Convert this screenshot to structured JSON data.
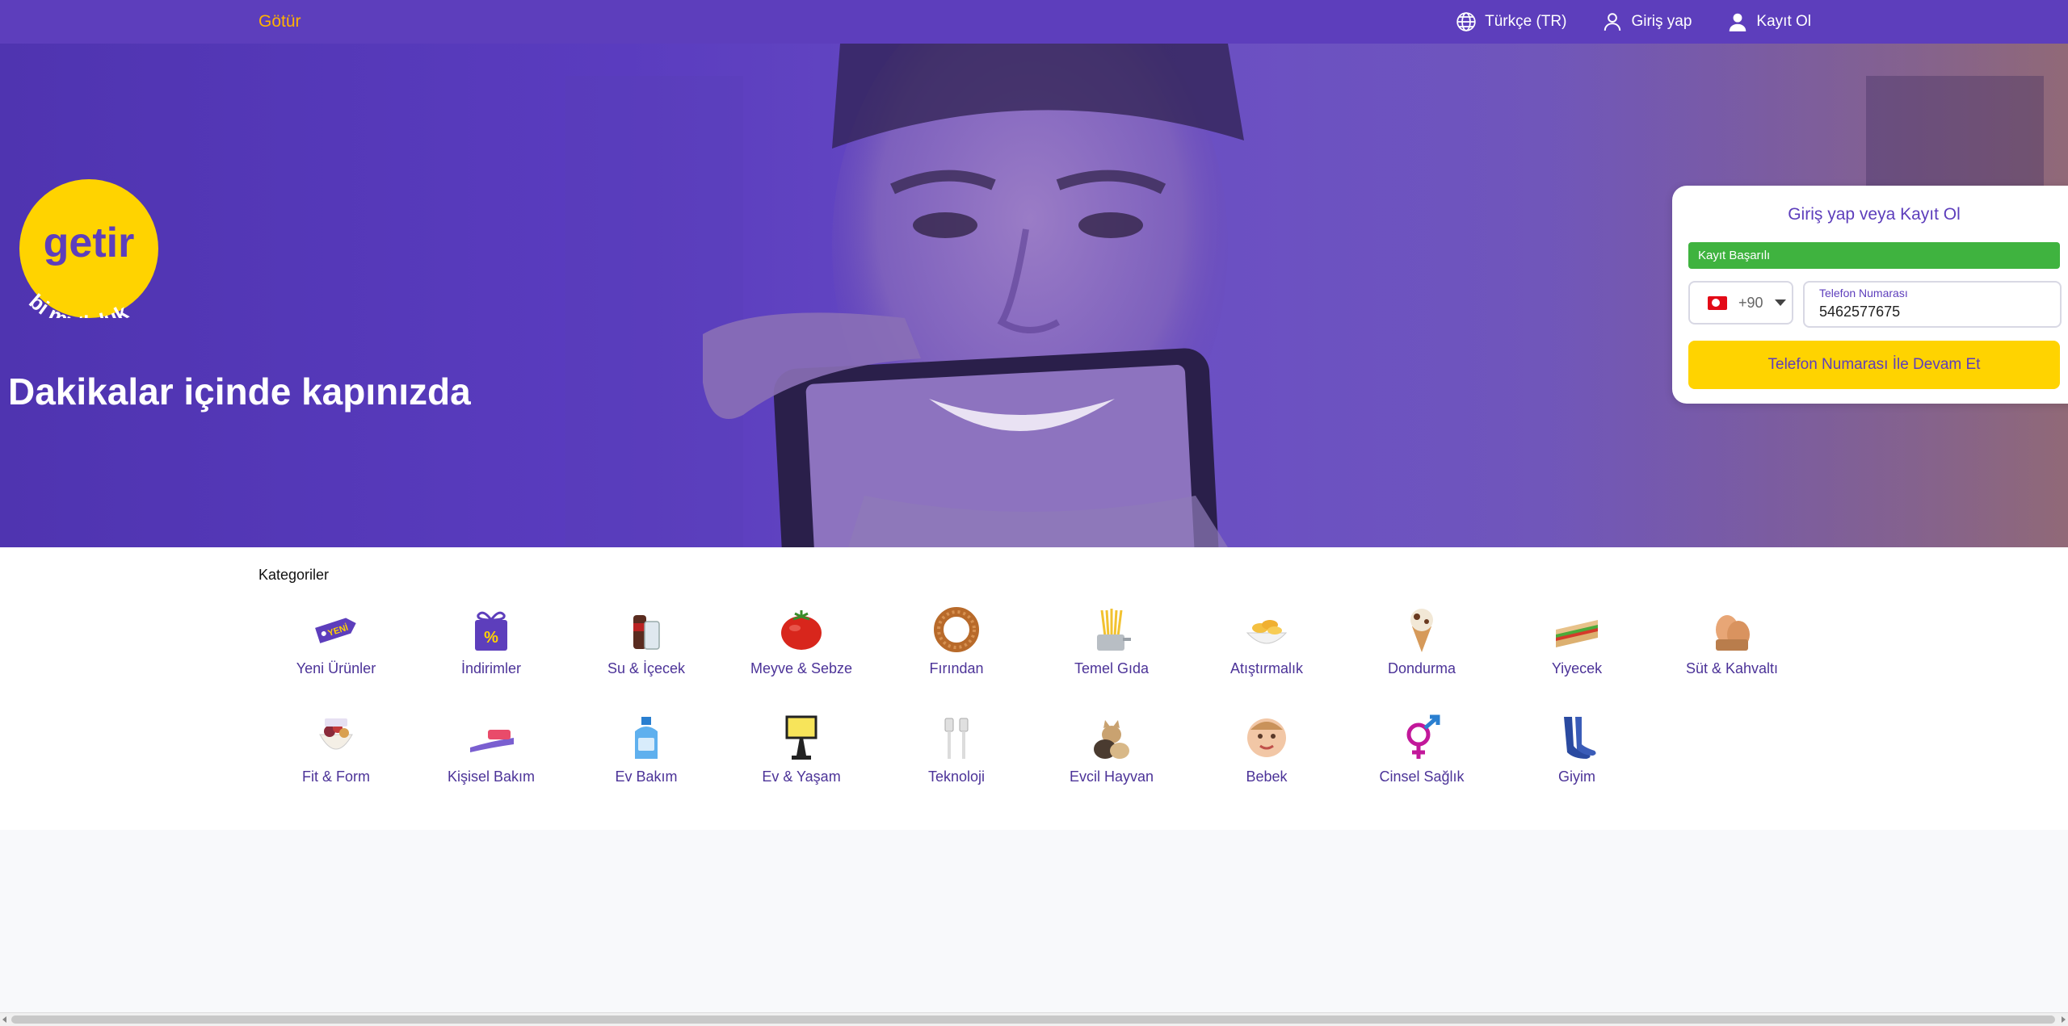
{
  "nav": {
    "brand": "Götür",
    "language": "Türkçe (TR)",
    "login": "Giriş yap",
    "register": "Kayıt Ol"
  },
  "hero": {
    "logo_text": "getir",
    "logo_slogan": "bi mutluluk",
    "title": "Dakikalar içinde kapınızda"
  },
  "login_card": {
    "title": "Giriş yap veya Kayıt Ol",
    "success_message": "Kayıt Başarılı",
    "country_code": "+90",
    "phone_label": "Telefon Numarası",
    "phone_value": "5462577675",
    "continue_label": "Telefon Numarası İle Devam Et"
  },
  "categories": {
    "heading": "Kategoriler",
    "items": [
      {
        "label": "Yeni Ürünler",
        "icon": "new-tag-icon"
      },
      {
        "label": "İndirimler",
        "icon": "discount-gift-icon"
      },
      {
        "label": "Su & İçecek",
        "icon": "drink-icon"
      },
      {
        "label": "Meyve & Sebze",
        "icon": "tomato-icon"
      },
      {
        "label": "Fırından",
        "icon": "simit-icon"
      },
      {
        "label": "Temel Gıda",
        "icon": "pasta-icon"
      },
      {
        "label": "Atıştırmalık",
        "icon": "chips-icon"
      },
      {
        "label": "Dondurma",
        "icon": "ice-cream-icon"
      },
      {
        "label": "Yiyecek",
        "icon": "sandwich-icon"
      },
      {
        "label": "Süt & Kahvaltı",
        "icon": "eggs-icon"
      },
      {
        "label": "Fit & Form",
        "icon": "granola-icon"
      },
      {
        "label": "Kişisel Bakım",
        "icon": "toothbrush-icon"
      },
      {
        "label": "Ev Bakım",
        "icon": "detergent-icon"
      },
      {
        "label": "Ev & Yaşam",
        "icon": "lamp-icon"
      },
      {
        "label": "Teknoloji",
        "icon": "cable-icon"
      },
      {
        "label": "Evcil Hayvan",
        "icon": "pets-icon"
      },
      {
        "label": "Bebek",
        "icon": "baby-icon"
      },
      {
        "label": "Cinsel Sağlık",
        "icon": "gender-icon"
      },
      {
        "label": "Giyim",
        "icon": "stockings-icon"
      }
    ]
  },
  "colors": {
    "brand_purple": "#5d3ebc",
    "brand_yellow": "#ffd300",
    "success_green": "#3fb33f"
  }
}
